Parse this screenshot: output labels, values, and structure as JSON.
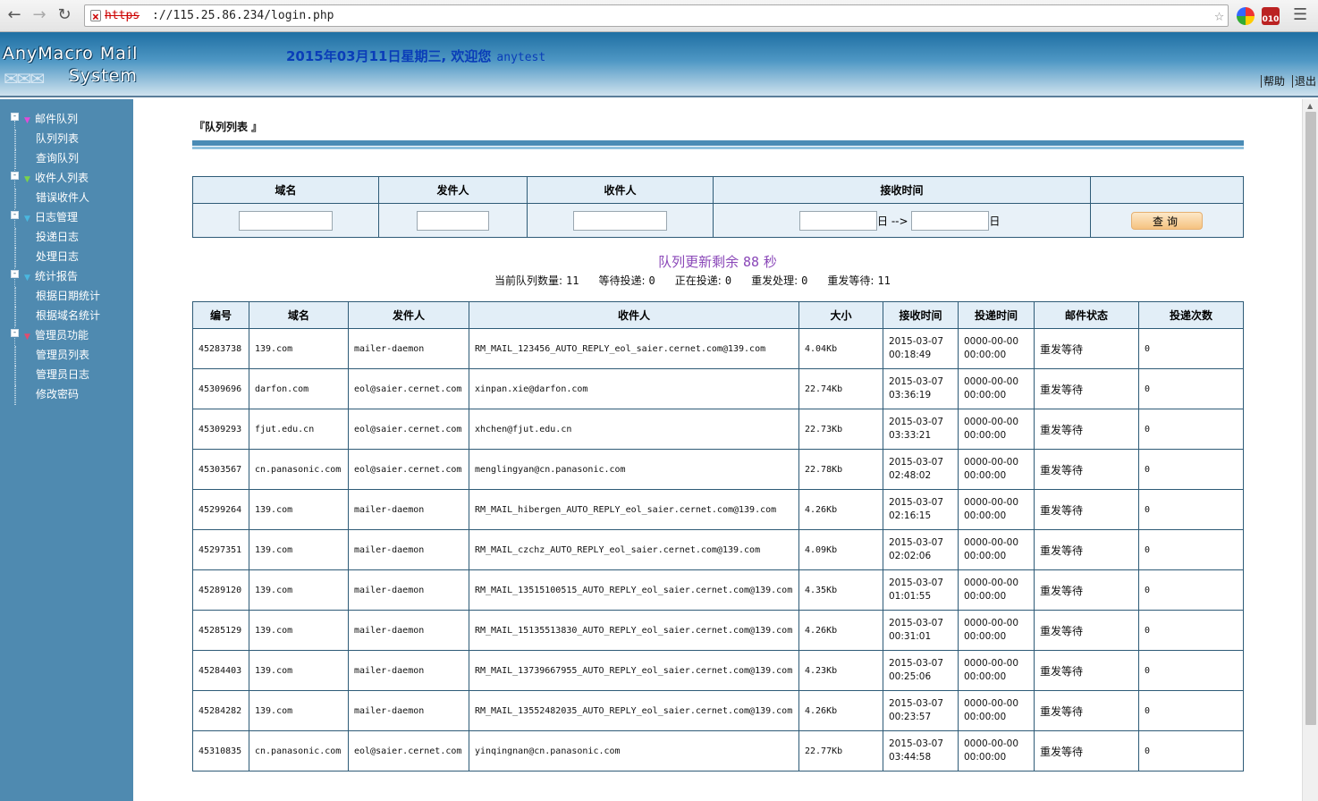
{
  "browser": {
    "scheme": "https",
    "url_rest": "://115.25.86.234/login.php",
    "ext2_label": "010"
  },
  "header": {
    "logo_line1": "AnyMacro Mail",
    "logo_line2": "System",
    "welcome": "2015年03月11日星期三, 欢迎您",
    "user": "anytest",
    "help": "帮助",
    "logout": "退出"
  },
  "sidebar": {
    "groups": [
      {
        "label": "邮件队列",
        "flag_color": "#e24bd8",
        "items": [
          "队列列表",
          "查询队列"
        ]
      },
      {
        "label": "收件人列表",
        "flag_color": "#7bd34a",
        "items": [
          "错误收件人"
        ]
      },
      {
        "label": "日志管理",
        "flag_color": "#4ab8e0",
        "items": [
          "投递日志",
          "处理日志"
        ]
      },
      {
        "label": "统计报告",
        "flag_color": "#4ab8e0",
        "items": [
          "根据日期统计",
          "根据域名统计"
        ]
      },
      {
        "label": "管理员功能",
        "flag_color": "#e24b6e",
        "items": [
          "管理员列表",
          "管理员日志",
          "修改密码"
        ]
      }
    ]
  },
  "main": {
    "crumb": "『队列列表 』",
    "search": {
      "headers": [
        "域名",
        "发件人",
        "收件人",
        "接收时间",
        ""
      ],
      "day_label": "日",
      "arrow": "-->",
      "query_label": "查询"
    },
    "countdown_prefix": "队列更新剩余",
    "countdown_value": "88",
    "countdown_suffix": "秒",
    "stats": [
      {
        "label": "当前队列数量:",
        "value": "11"
      },
      {
        "label": "等待投递:",
        "value": "0"
      },
      {
        "label": "正在投递:",
        "value": "0"
      },
      {
        "label": "重发处理:",
        "value": "0"
      },
      {
        "label": "重发等待:",
        "value": "11"
      }
    ],
    "columns": [
      "编号",
      "域名",
      "发件人",
      "收件人",
      "大小",
      "接收时间",
      "投递时间",
      "邮件状态",
      "投递次数"
    ],
    "rows": [
      [
        "45283738",
        "139.com",
        "mailer-daemon",
        "RM_MAIL_123456_AUTO_REPLY_eol_saier.cernet.com@139.com",
        "4.04Kb",
        "2015-03-07 00:18:49",
        "0000-00-00 00:00:00",
        "重发等待",
        "0"
      ],
      [
        "45309696",
        "darfon.com",
        "eol@saier.cernet.com",
        "xinpan.xie@darfon.com",
        "22.74Kb",
        "2015-03-07 03:36:19",
        "0000-00-00 00:00:00",
        "重发等待",
        "0"
      ],
      [
        "45309293",
        "fjut.edu.cn",
        "eol@saier.cernet.com",
        "xhchen@fjut.edu.cn",
        "22.73Kb",
        "2015-03-07 03:33:21",
        "0000-00-00 00:00:00",
        "重发等待",
        "0"
      ],
      [
        "45303567",
        "cn.panasonic.com",
        "eol@saier.cernet.com",
        "menglingyan@cn.panasonic.com",
        "22.78Kb",
        "2015-03-07 02:48:02",
        "0000-00-00 00:00:00",
        "重发等待",
        "0"
      ],
      [
        "45299264",
        "139.com",
        "mailer-daemon",
        "RM_MAIL_hibergen_AUTO_REPLY_eol_saier.cernet.com@139.com",
        "4.26Kb",
        "2015-03-07 02:16:15",
        "0000-00-00 00:00:00",
        "重发等待",
        "0"
      ],
      [
        "45297351",
        "139.com",
        "mailer-daemon",
        "RM_MAIL_czchz_AUTO_REPLY_eol_saier.cernet.com@139.com",
        "4.09Kb",
        "2015-03-07 02:02:06",
        "0000-00-00 00:00:00",
        "重发等待",
        "0"
      ],
      [
        "45289120",
        "139.com",
        "mailer-daemon",
        "RM_MAIL_13515100515_AUTO_REPLY_eol_saier.cernet.com@139.com",
        "4.35Kb",
        "2015-03-07 01:01:55",
        "0000-00-00 00:00:00",
        "重发等待",
        "0"
      ],
      [
        "45285129",
        "139.com",
        "mailer-daemon",
        "RM_MAIL_15135513830_AUTO_REPLY_eol_saier.cernet.com@139.com",
        "4.26Kb",
        "2015-03-07 00:31:01",
        "0000-00-00 00:00:00",
        "重发等待",
        "0"
      ],
      [
        "45284403",
        "139.com",
        "mailer-daemon",
        "RM_MAIL_13739667955_AUTO_REPLY_eol_saier.cernet.com@139.com",
        "4.23Kb",
        "2015-03-07 00:25:06",
        "0000-00-00 00:00:00",
        "重发等待",
        "0"
      ],
      [
        "45284282",
        "139.com",
        "mailer-daemon",
        "RM_MAIL_13552482035_AUTO_REPLY_eol_saier.cernet.com@139.com",
        "4.26Kb",
        "2015-03-07 00:23:57",
        "0000-00-00 00:00:00",
        "重发等待",
        "0"
      ],
      [
        "45310835",
        "cn.panasonic.com",
        "eol@saier.cernet.com",
        "yinqingnan@cn.panasonic.com",
        "22.77Kb",
        "2015-03-07 03:44:58",
        "0000-00-00 00:00:00",
        "重发等待",
        "0"
      ]
    ]
  }
}
